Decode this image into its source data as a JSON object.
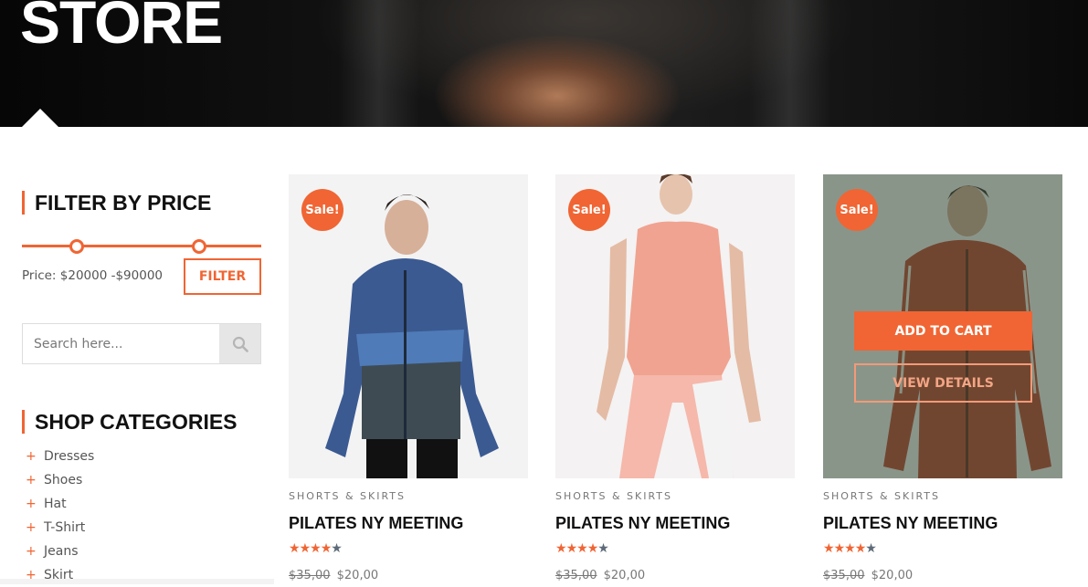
{
  "hero": {
    "title": "STORE"
  },
  "sidebar": {
    "filter_title": "FILTER BY PRICE",
    "price_range_text": "Price: $20000 -$90000",
    "price_range_fraction": [
      0.23,
      0.74
    ],
    "filter_button": "FILTER",
    "search_placeholder": "Search here...",
    "search_icon": "search-icon",
    "categories_title": "SHOP CATEGORIES",
    "categories": [
      {
        "label": "Dresses"
      },
      {
        "label": "Shoes"
      },
      {
        "label": "Hat"
      },
      {
        "label": "T-Shirt"
      },
      {
        "label": "Jeans"
      },
      {
        "label": "Skirt"
      }
    ]
  },
  "products": [
    {
      "badge": "Sale!",
      "category": "SHORTS & SKIRTS",
      "name": "PILATES NY MEETING",
      "rating": 4,
      "rating_max": 5,
      "old_price": "$35,00",
      "price": "$20,00"
    },
    {
      "badge": "Sale!",
      "category": "SHORTS & SKIRTS",
      "name": "PILATES NY MEETING",
      "rating": 4,
      "rating_max": 5,
      "old_price": "$35,00",
      "price": "$20,00"
    },
    {
      "badge": "Sale!",
      "category": "SHORTS & SKIRTS",
      "name": "PILATES NY MEETING",
      "rating": 4,
      "rating_max": 5,
      "old_price": "$35,00",
      "price": "$20,00",
      "add_to_cart": "ADD TO CART",
      "view_details": "VIEW DETAILS"
    }
  ],
  "colors": {
    "accent": "#f06533",
    "star_off": "#5d6a78"
  }
}
